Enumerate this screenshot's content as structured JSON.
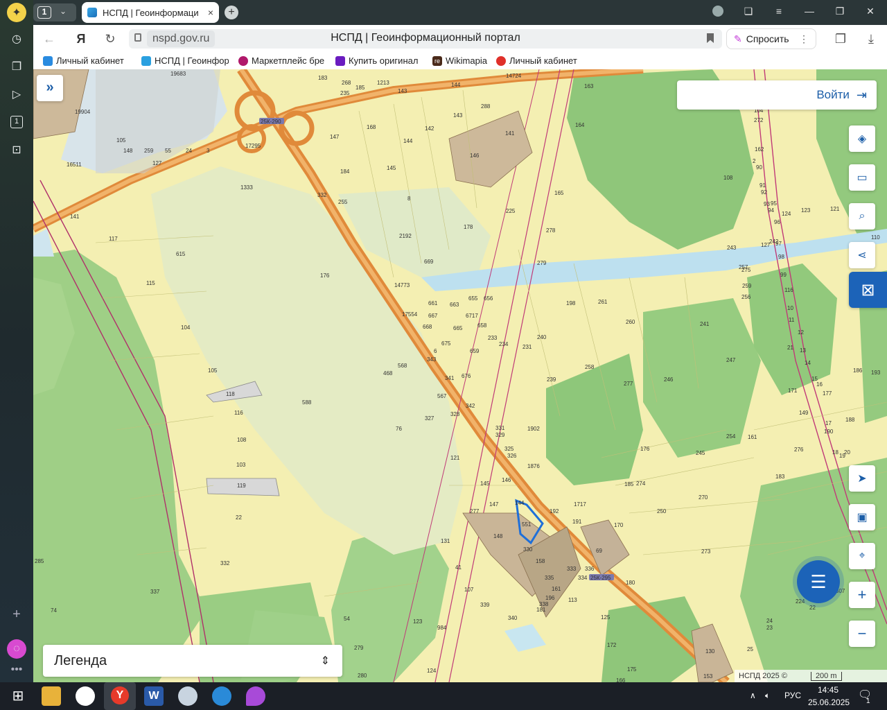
{
  "browser": {
    "tab_count": "1",
    "active_tab": {
      "title": "НСПД | Геоинформаци",
      "close": "×"
    },
    "new_tab": "+",
    "url": "nspd.gov.ru",
    "page_title": "НСПД | Геоинформационный портал",
    "ask_label": "Спросить",
    "bookmarks": [
      {
        "label": "Личный кабинет",
        "color": "#2a8be0"
      },
      {
        "label": "НСПД | Геоинфор",
        "color": "#2aa0e0"
      },
      {
        "label": "Маркетплейс бре",
        "color": "#b0186a"
      },
      {
        "label": "Купить оригинал",
        "color": "#6a1cc0"
      },
      {
        "label": "Wikimapia",
        "color": "#4a2a1a"
      },
      {
        "label": "Личный кабинет",
        "color": "#e0302a"
      }
    ],
    "bookmark_re": "re"
  },
  "map": {
    "login_label": "Войти",
    "legend_label": "Легенда",
    "attribution": "НСПД 2025 ©",
    "scale_label": "200 m",
    "road_labels": [
      "25К-290",
      "25К-295"
    ],
    "parcel_labels": [
      {
        "t": "19683"
      },
      {
        "t": "19904"
      },
      {
        "t": "105"
      },
      {
        "t": "127"
      },
      {
        "t": "17295"
      },
      {
        "t": "183"
      },
      {
        "t": "268"
      },
      {
        "t": "185"
      },
      {
        "t": "235"
      },
      {
        "t": "1213"
      },
      {
        "t": "143"
      },
      {
        "t": "144"
      },
      {
        "t": "14724"
      },
      {
        "t": "163"
      },
      {
        "t": "288"
      },
      {
        "t": "143"
      },
      {
        "t": "168"
      },
      {
        "t": "142"
      },
      {
        "t": "141"
      },
      {
        "t": "147"
      },
      {
        "t": "144"
      },
      {
        "t": "146"
      },
      {
        "t": "164"
      },
      {
        "t": "184"
      },
      {
        "t": "145"
      },
      {
        "t": "1333"
      },
      {
        "t": "332"
      },
      {
        "t": "255"
      },
      {
        "t": "8"
      },
      {
        "t": "165"
      },
      {
        "t": "225"
      },
      {
        "t": "178"
      },
      {
        "t": "278"
      },
      {
        "t": "117"
      },
      {
        "t": "615"
      },
      {
        "t": "2192"
      },
      {
        "t": "669"
      },
      {
        "t": "279"
      },
      {
        "t": "176"
      },
      {
        "t": "115"
      },
      {
        "t": "14773"
      },
      {
        "t": "661"
      },
      {
        "t": "663"
      },
      {
        "t": "655"
      },
      {
        "t": "656"
      },
      {
        "t": "198"
      },
      {
        "t": "261"
      },
      {
        "t": "17554"
      },
      {
        "t": "667"
      },
      {
        "t": "6717"
      },
      {
        "t": "668"
      },
      {
        "t": "665"
      },
      {
        "t": "658"
      },
      {
        "t": "104"
      },
      {
        "t": "675"
      },
      {
        "t": "233"
      },
      {
        "t": "234"
      },
      {
        "t": "231"
      },
      {
        "t": "240"
      },
      {
        "t": "6"
      },
      {
        "t": "659"
      },
      {
        "t": "343"
      },
      {
        "t": "568"
      },
      {
        "t": "105"
      },
      {
        "t": "468"
      },
      {
        "t": "341"
      },
      {
        "t": "676"
      },
      {
        "t": "239"
      },
      {
        "t": "258"
      },
      {
        "t": "118"
      },
      {
        "t": "567"
      },
      {
        "t": "342"
      },
      {
        "t": "588"
      },
      {
        "t": "116"
      },
      {
        "t": "328"
      },
      {
        "t": "327"
      },
      {
        "t": "76"
      },
      {
        "t": "331"
      },
      {
        "t": "1902"
      },
      {
        "t": "329"
      },
      {
        "t": "108"
      },
      {
        "t": "325"
      },
      {
        "t": "326"
      },
      {
        "t": "103"
      },
      {
        "t": "121"
      },
      {
        "t": "1876"
      },
      {
        "t": "119"
      },
      {
        "t": "145"
      },
      {
        "t": "146"
      },
      {
        "t": "147"
      },
      {
        "t": "144"
      },
      {
        "t": "22"
      },
      {
        "t": "277"
      },
      {
        "t": "192"
      },
      {
        "t": "551"
      },
      {
        "t": "191"
      },
      {
        "t": "148"
      },
      {
        "t": "131"
      },
      {
        "t": "330"
      },
      {
        "t": "332"
      },
      {
        "t": "41"
      },
      {
        "t": "158"
      },
      {
        "t": "333"
      },
      {
        "t": "335"
      },
      {
        "t": "334"
      },
      {
        "t": "336"
      },
      {
        "t": "107"
      },
      {
        "t": "161"
      },
      {
        "t": "337"
      },
      {
        "t": "196"
      },
      {
        "t": "338"
      },
      {
        "t": "339"
      },
      {
        "t": "113"
      },
      {
        "t": "181"
      },
      {
        "t": "340"
      },
      {
        "t": "74"
      },
      {
        "t": "54"
      },
      {
        "t": "123"
      },
      {
        "t": "984"
      },
      {
        "t": "279"
      },
      {
        "t": "124"
      },
      {
        "t": "280"
      },
      {
        "t": "125"
      },
      {
        "t": "69"
      },
      {
        "t": "180"
      },
      {
        "t": "1717"
      },
      {
        "t": "185"
      },
      {
        "t": "170"
      },
      {
        "t": "274"
      },
      {
        "t": "250"
      },
      {
        "t": "270"
      },
      {
        "t": "273"
      },
      {
        "t": "176"
      },
      {
        "t": "245"
      },
      {
        "t": "254"
      },
      {
        "t": "161"
      },
      {
        "t": "183"
      },
      {
        "t": "276"
      },
      {
        "t": "149"
      },
      {
        "t": "171"
      },
      {
        "t": "190"
      },
      {
        "t": "177"
      },
      {
        "t": "188"
      },
      {
        "t": "186"
      },
      {
        "t": "193"
      },
      {
        "t": "277"
      },
      {
        "t": "246"
      },
      {
        "t": "247"
      },
      {
        "t": "241"
      },
      {
        "t": "260"
      },
      {
        "t": "256"
      },
      {
        "t": "259"
      },
      {
        "t": "243"
      },
      {
        "t": "257"
      },
      {
        "t": "275"
      },
      {
        "t": "127"
      },
      {
        "t": "242"
      },
      {
        "t": "124"
      },
      {
        "t": "123"
      },
      {
        "t": "121"
      },
      {
        "t": "113"
      },
      {
        "t": "110"
      },
      {
        "t": "108"
      },
      {
        "t": "104"
      },
      {
        "t": "272"
      },
      {
        "t": "162"
      },
      {
        "t": "2"
      },
      {
        "t": "90"
      },
      {
        "t": "91"
      },
      {
        "t": "92"
      },
      {
        "t": "93"
      },
      {
        "t": "94"
      },
      {
        "t": "95"
      },
      {
        "t": "96"
      },
      {
        "t": "97"
      },
      {
        "t": "98"
      },
      {
        "t": "99"
      },
      {
        "t": "116"
      },
      {
        "t": "10"
      },
      {
        "t": "11"
      },
      {
        "t": "12"
      },
      {
        "t": "13"
      },
      {
        "t": "14"
      },
      {
        "t": "15"
      },
      {
        "t": "16"
      },
      {
        "t": "17"
      },
      {
        "t": "18"
      },
      {
        "t": "19"
      },
      {
        "t": "20"
      },
      {
        "t": "21"
      },
      {
        "t": "22"
      },
      {
        "t": "23"
      },
      {
        "t": "24"
      },
      {
        "t": "25"
      },
      {
        "t": "130"
      },
      {
        "t": "172"
      },
      {
        "t": "175"
      },
      {
        "t": "153"
      },
      {
        "t": "166"
      },
      {
        "t": "224"
      },
      {
        "t": "307"
      },
      {
        "t": "285"
      },
      {
        "t": "141"
      },
      {
        "t": "16511"
      },
      {
        "t": "148"
      },
      {
        "t": "259"
      },
      {
        "t": "55"
      },
      {
        "t": "24"
      },
      {
        "t": "3"
      }
    ]
  },
  "taskbar": {
    "lang": "РУС",
    "time": "14:45",
    "date": "25.06.2025",
    "notif_count": "1"
  }
}
